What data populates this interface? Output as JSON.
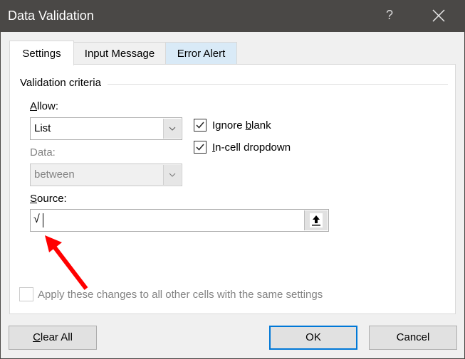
{
  "window": {
    "title": "Data Validation",
    "help_label": "?",
    "close_icon": "close-icon"
  },
  "tabs": [
    {
      "label": "Settings",
      "active": true
    },
    {
      "label": "Input Message",
      "active": false
    },
    {
      "label": "Error Alert",
      "active": false
    }
  ],
  "settings": {
    "group_title": "Validation criteria",
    "allow": {
      "label_accel": "A",
      "label_rest": "llow:",
      "value": "List"
    },
    "data": {
      "label": "Data:",
      "value": "between",
      "disabled": true
    },
    "ignore_blank": {
      "label_pre": "Ignore ",
      "label_accel": "b",
      "label_rest": "lank",
      "checked": true
    },
    "in_cell_dropdown": {
      "label_accel": "I",
      "label_rest": "n-cell dropdown",
      "checked": true
    },
    "source": {
      "label_accel": "S",
      "label_rest": "ource:",
      "value": "√",
      "ref_button_icon": "collapse-dialog-arrow-up-icon"
    },
    "apply_all": {
      "label": "Apply these changes to all other cells with the same settings",
      "checked": false,
      "disabled": true
    }
  },
  "annotation": {
    "arrow_color": "#ff0000"
  },
  "buttons": {
    "clear_all_accel": "C",
    "clear_all_rest": "lear All",
    "ok": "OK",
    "cancel": "Cancel"
  },
  "colors": {
    "titlebar": "#4a4846",
    "accent": "#0078d7",
    "active_tab_hover": "#d9eaf7"
  }
}
